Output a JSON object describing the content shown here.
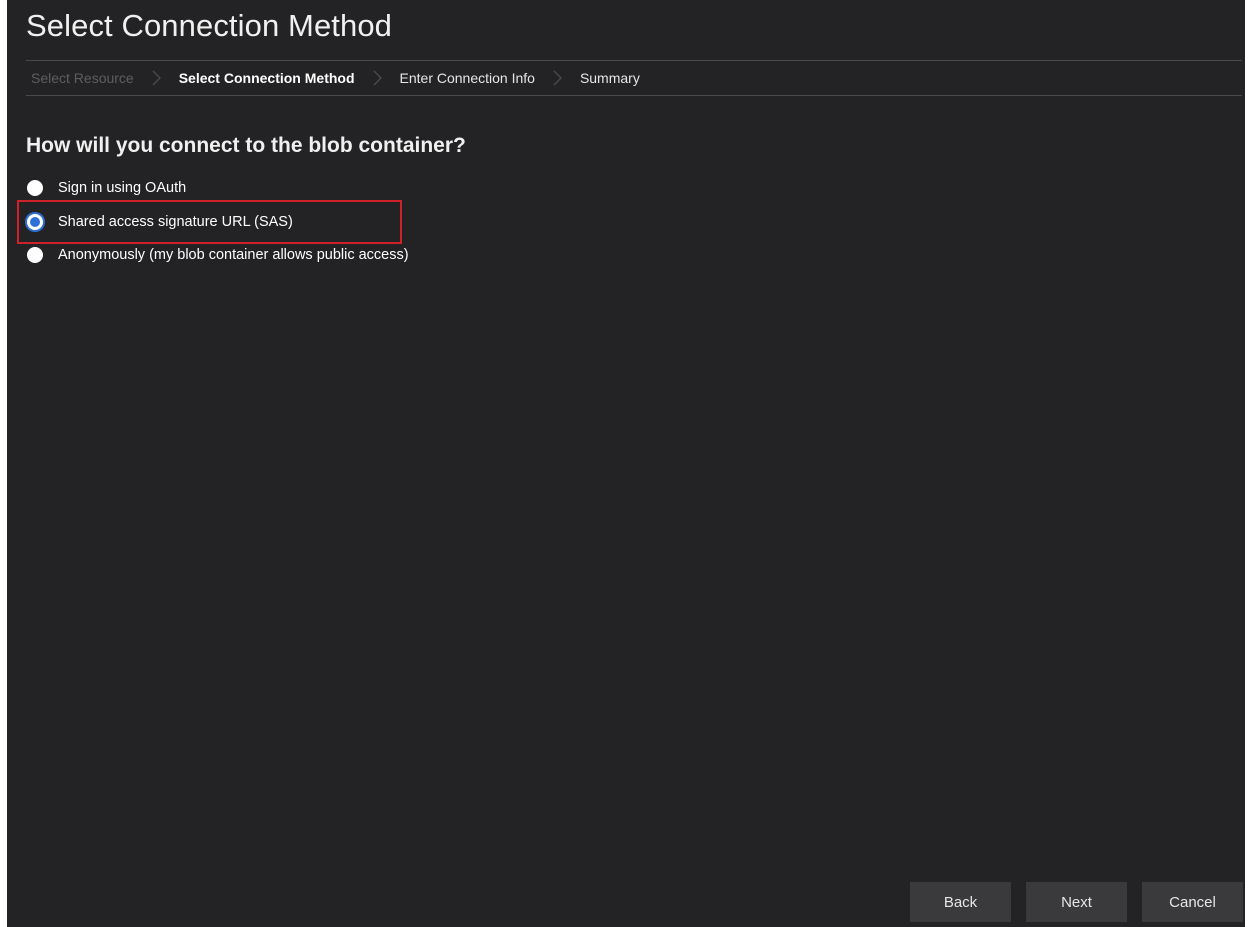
{
  "page": {
    "title": "Select Connection Method"
  },
  "breadcrumb": {
    "steps": [
      {
        "label": "Select Resource"
      },
      {
        "label": "Select Connection Method"
      },
      {
        "label": "Enter Connection Info"
      },
      {
        "label": "Summary"
      }
    ]
  },
  "question": "How will you connect to the blob container?",
  "options": [
    {
      "label": "Sign in using OAuth",
      "selected": false
    },
    {
      "label": "Shared access signature URL (SAS)",
      "selected": true
    },
    {
      "label": "Anonymously (my blob container allows public access)",
      "selected": false
    }
  ],
  "buttons": {
    "back": "Back",
    "next": "Next",
    "cancel": "Cancel"
  },
  "colors": {
    "background": "#232325",
    "accent": "#2f6fd8",
    "highlight": "#d0202a"
  }
}
